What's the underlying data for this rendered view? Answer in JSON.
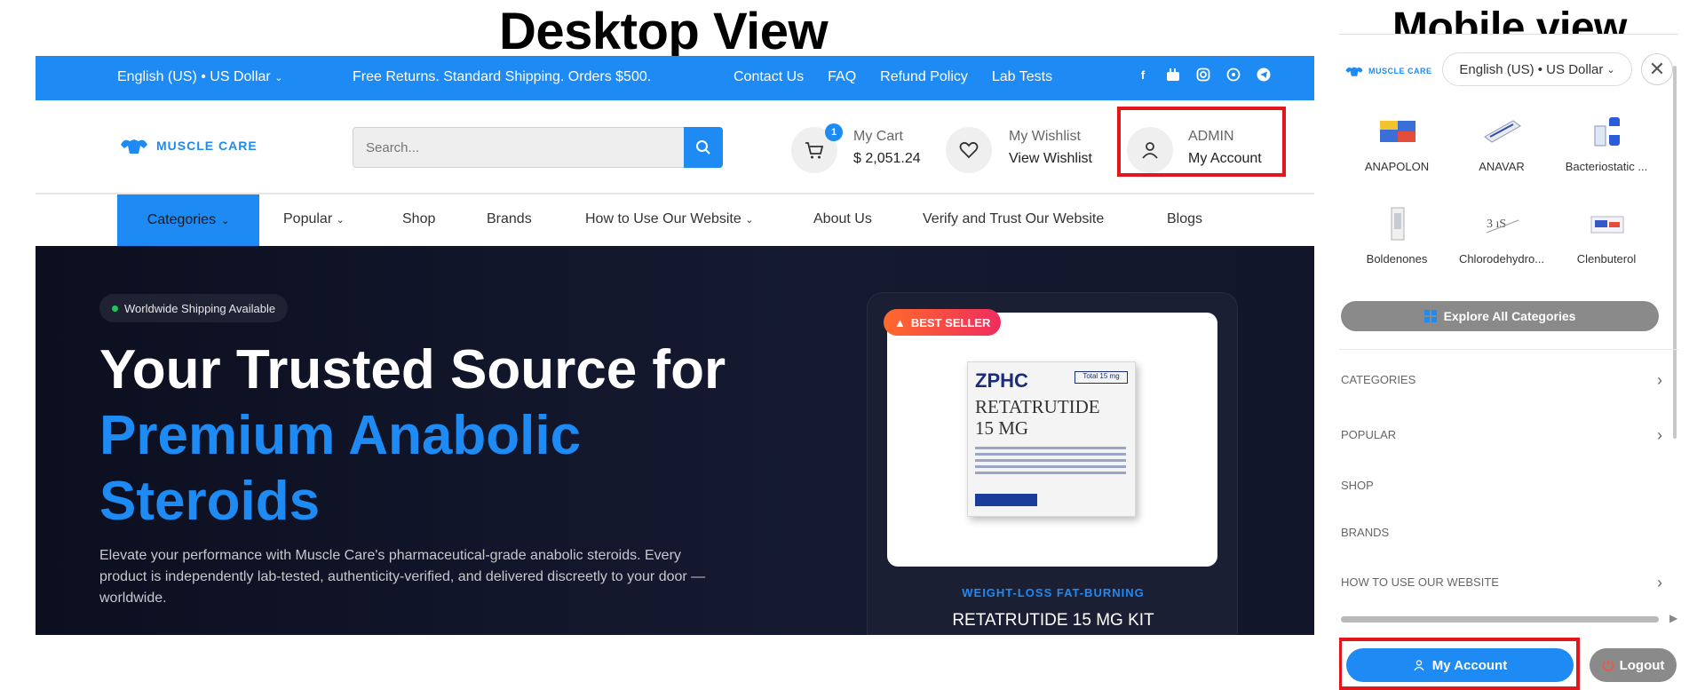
{
  "titles": {
    "desktop": "Desktop View",
    "mobile": "Mobile view"
  },
  "desktop": {
    "topbar": {
      "language": "English (US) • US Dollar",
      "promo": "Free Returns. Standard Shipping. Orders $500.",
      "links": [
        "Contact Us",
        "FAQ",
        "Refund Policy",
        "Lab Tests"
      ],
      "socials": [
        "facebook-icon",
        "youtube-icon",
        "instagram-icon",
        "whatsapp-icon",
        "telegram-icon"
      ]
    },
    "header": {
      "logo_text": "MUSCLE CARE",
      "search_placeholder": "Search...",
      "cart": {
        "badge": "1",
        "label": "My Cart",
        "amount": "$ 2,051.24"
      },
      "wishlist": {
        "label": "My Wishlist",
        "link": "View Wishlist"
      },
      "account": {
        "name": "ADMIN",
        "link": "My Account"
      }
    },
    "nav": {
      "categories": "Categories",
      "items": [
        "Popular",
        "Shop",
        "Brands",
        "How to Use Our Website",
        "About Us",
        "Verify and Trust Our Website",
        "Blogs"
      ]
    },
    "hero": {
      "badge": "Worldwide Shipping Available",
      "title_line1": "Your Trusted Source for",
      "title_line2": "Premium Anabolic",
      "title_line3": "Steroids",
      "description": "Elevate your performance with Muscle Care's pharmaceutical-grade anabolic steroids. Every product is independently lab-tested, authenticity-verified, and delivered discreetly to your door — worldwide."
    },
    "product": {
      "badge": "BEST SELLER",
      "box_brand": "ZPHC",
      "box_strip": "Total 15 mg",
      "box_name_line1": "RETATRUTIDE",
      "box_name_line2": "15 MG",
      "category": "WEIGHT-LOSS FAT-BURNING",
      "name": "RETATRUTIDE 15 MG KIT"
    }
  },
  "mobile": {
    "logo_text": "MUSCLE CARE",
    "language": "English (US) • US Dollar",
    "close": "✕",
    "categories": [
      "ANAPOLON",
      "ANAVAR",
      "Bacteriostatic ...",
      "Boldenones",
      "Chlorodehydro...",
      "Clenbuterol"
    ],
    "explore": "Explore All Categories",
    "menu": [
      {
        "label": "CATEGORIES",
        "chevron": "›"
      },
      {
        "label": "POPULAR",
        "chevron": "›"
      },
      {
        "label": "SHOP",
        "chevron": ""
      },
      {
        "label": "BRANDS",
        "chevron": ""
      },
      {
        "label": "HOW TO USE OUR WEBSITE",
        "chevron": "›"
      }
    ],
    "account_button": "My Account",
    "logout_button": "Logout"
  },
  "colors": {
    "brand_blue": "#1e8af3",
    "highlight_red": "#e3171b",
    "hero_bg": "#0c0f1f",
    "gray_button": "#8a8a8a"
  }
}
